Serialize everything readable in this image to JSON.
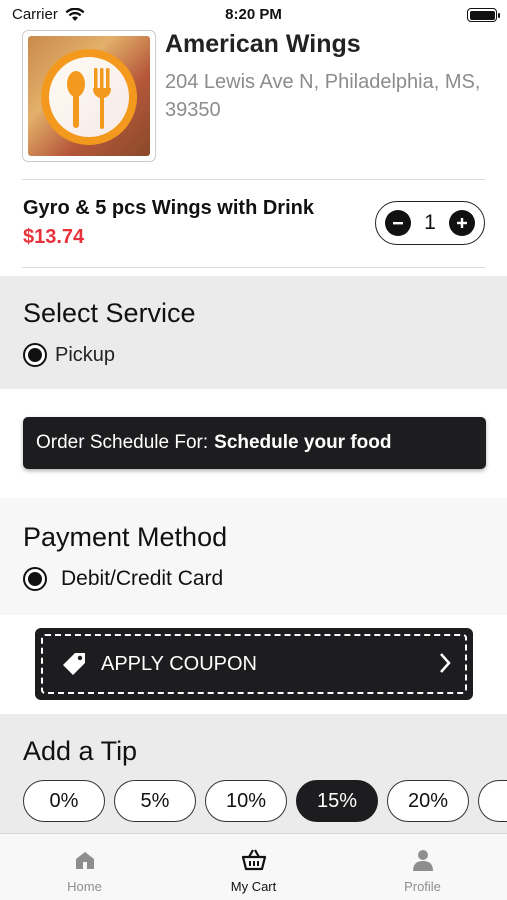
{
  "status_bar": {
    "carrier": "Carrier",
    "time": "8:20 PM"
  },
  "restaurant": {
    "name": "American Wings",
    "address": "204 Lewis Ave N, Philadelphia, MS, 39350",
    "logo_icon": "fork-spoon-icon"
  },
  "cart_item": {
    "name": "Gyro & 5 pcs Wings with Drink",
    "price": "$13.74",
    "quantity": "1"
  },
  "service": {
    "title": "Select Service",
    "option": "Pickup"
  },
  "schedule": {
    "prefix": "Order Schedule For:",
    "value": "Schedule your food"
  },
  "payment": {
    "title": "Payment Method",
    "option": "Debit/Credit Card"
  },
  "coupon": {
    "label": "APPLY COUPON"
  },
  "tip": {
    "title": "Add a Tip",
    "options": [
      "0%",
      "5%",
      "10%",
      "15%",
      "20%"
    ],
    "selected": "15%"
  },
  "tabs": [
    {
      "label": "Home",
      "icon": "home-icon"
    },
    {
      "label": "My Cart",
      "icon": "basket-icon"
    },
    {
      "label": "Profile",
      "icon": "person-icon"
    }
  ],
  "colors": {
    "price": "#e8323c",
    "dark": "#1d1d1f",
    "logo_orange": "#f39a1e"
  }
}
